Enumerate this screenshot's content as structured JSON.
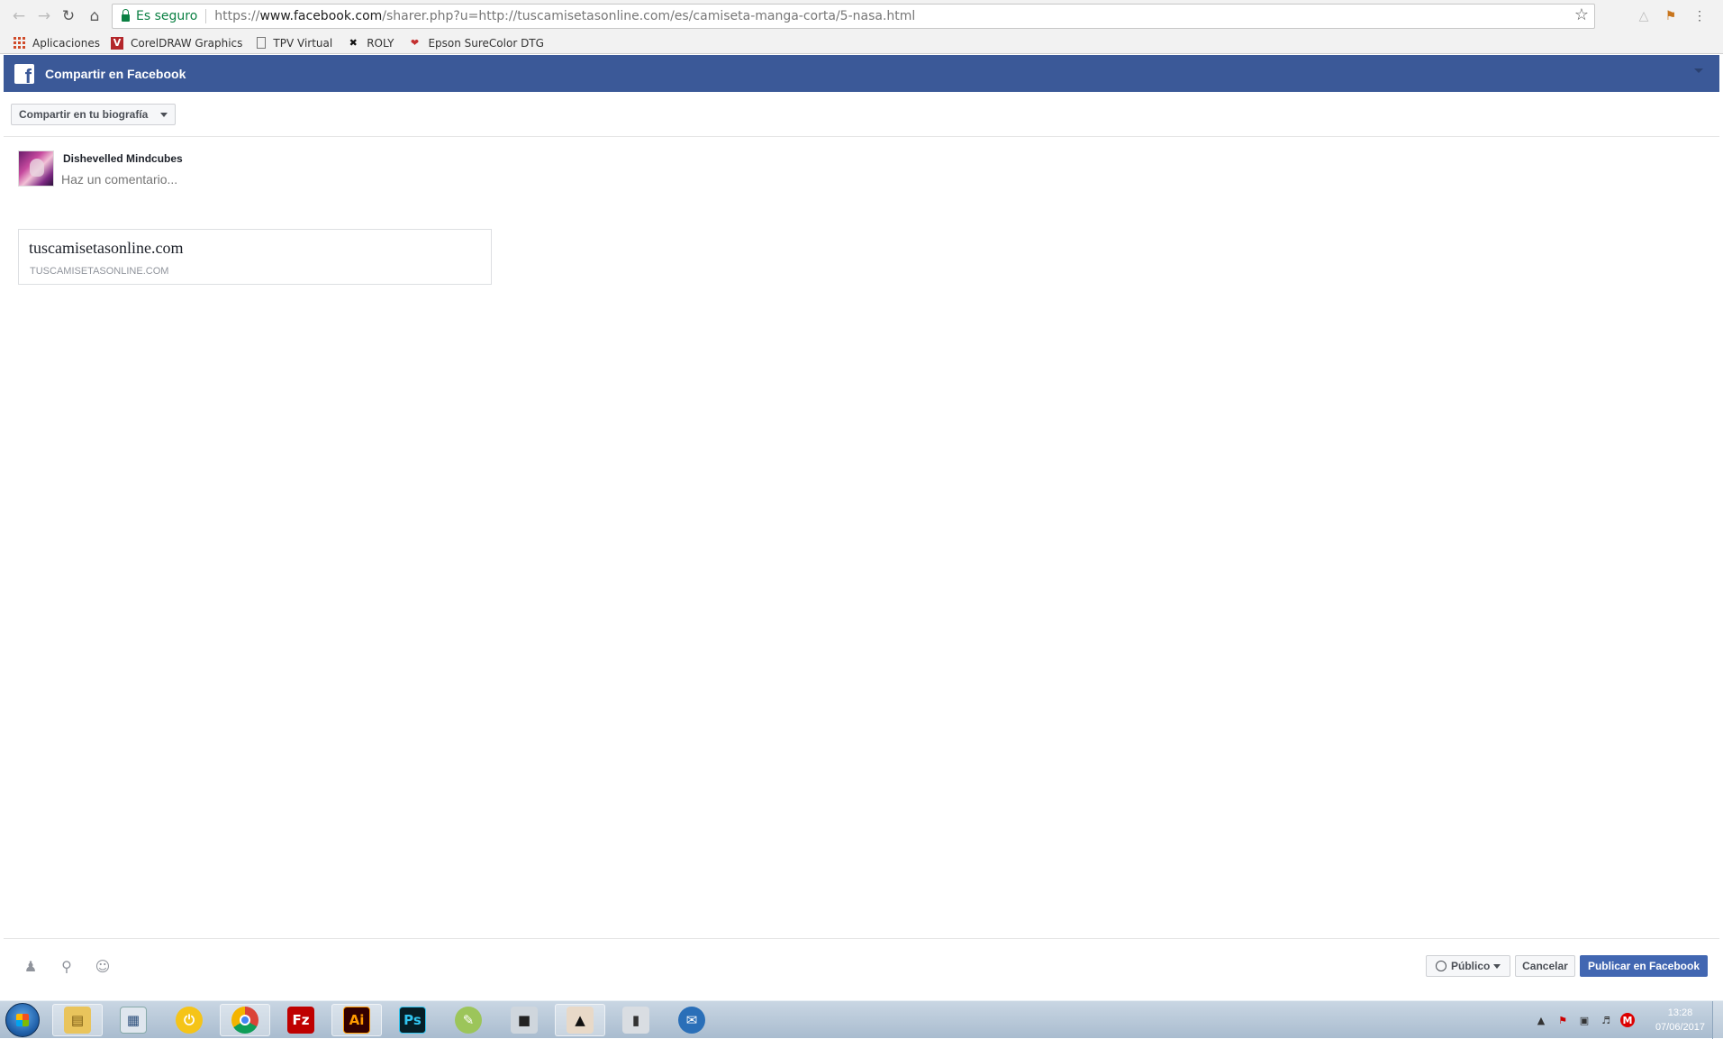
{
  "browser": {
    "nav": {
      "back_icon": "back-arrow-icon",
      "forward_icon": "forward-arrow-icon",
      "reload_icon": "reload-icon",
      "home_icon": "home-icon"
    },
    "security_label": "Es seguro",
    "url_scheme": "https://",
    "url_domain": "www.facebook.com",
    "url_rest": "/sharer.php?u=http://tuscamisetasonline.com/es/camiseta-manga-corta/5-nasa.html",
    "bookmark_star_icon": "star-icon",
    "extensions": [
      "pdf-extension-icon",
      "bookmark-flag-icon"
    ],
    "menu_icon": "kebab-menu-icon"
  },
  "bookmarks": [
    {
      "label": "Aplicaciones",
      "icon": "apps-grid-icon"
    },
    {
      "label": "CorelDRAW Graphics",
      "icon": "coreldraw-icon"
    },
    {
      "label": "TPV Virtual",
      "icon": "page-icon"
    },
    {
      "label": "ROLY",
      "icon": "roly-icon"
    },
    {
      "label": "Epson SureColor DTG",
      "icon": "epson-icon"
    }
  ],
  "dialog": {
    "title": "Compartir en Facebook",
    "share_target": "Compartir en tu biografía",
    "user_name": "Dishevelled Mindcubes",
    "comment_placeholder": "Haz un comentario...",
    "preview": {
      "title": "tuscamisetasonline.com",
      "domain": "TUSCAMISETASONLINE.COM"
    },
    "footer": {
      "tag_icon": "tag-friends-icon",
      "location_icon": "location-pin-icon",
      "feeling_icon": "smiley-icon",
      "privacy_label": "Público",
      "cancel_label": "Cancelar",
      "publish_label": "Publicar en Facebook"
    }
  },
  "taskbar": {
    "apps": [
      "file-explorer-icon",
      "calculator-icon",
      "power-app-icon",
      "chrome-icon",
      "filezilla-icon",
      "illustrator-icon",
      "photoshop-icon",
      "inkscape-icon",
      "tshirt-app-icon",
      "printer-app-icon",
      "book-app-icon",
      "thunderbird-icon"
    ],
    "time": "13:28",
    "date": "07/06/2017"
  },
  "colors": {
    "facebook_blue": "#3b5998",
    "publish_blue": "#4267b2",
    "secure_green": "#0b8043"
  }
}
